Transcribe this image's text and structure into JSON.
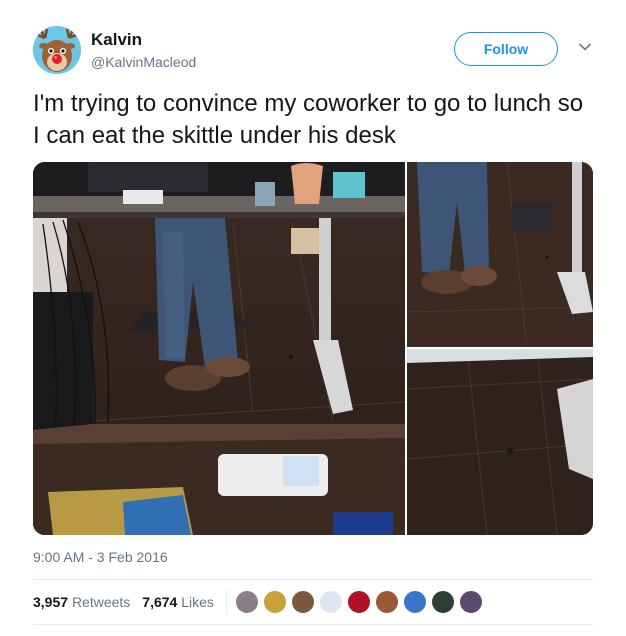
{
  "author": {
    "name": "Kalvin",
    "handle": "@KalvinMacleod",
    "avatar_icon": "reindeer-avatar-icon"
  },
  "follow_label": "Follow",
  "caret_icon": "chevron-down-icon",
  "tweet": {
    "text": "I'm trying to convince my coworker to go to lunch so I can eat the skittle under his desk",
    "timestamp": "9:00 AM - 3 Feb 2016"
  },
  "media": {
    "photos": [
      "desk-photo-main",
      "desk-photo-legs",
      "desk-photo-floor-skittle"
    ]
  },
  "stats": {
    "retweets_count": "3,957",
    "retweets_label": "Retweets",
    "likes_count": "7,674",
    "likes_label": "Likes"
  },
  "likers": {
    "avatar_colors": [
      "#8a7f86",
      "#c9a23a",
      "#7a5a3c",
      "#dfe7ee",
      "#b01224",
      "#9a5a36",
      "#3b75c9",
      "#2d3e34",
      "#5b4a6e"
    ]
  },
  "colors": {
    "accent": "#1b95e0",
    "muted": "#657786",
    "text": "#14171a"
  }
}
